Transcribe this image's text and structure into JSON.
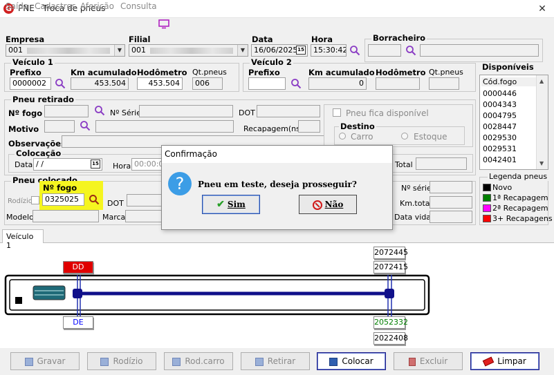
{
  "window": {
    "title": "PNE - Troca de pneus",
    "app_icon_letter": "G",
    "close": "✕"
  },
  "menu": [
    "Saída",
    "Cadastros",
    "Aferição",
    "Consulta"
  ],
  "header": {
    "empresa_label": "Empresa",
    "empresa_value": "001",
    "filial_label": "Filial",
    "filial_value": "001",
    "data_label": "Data",
    "data_value": "16/06/2025",
    "hora_label": "Hora",
    "hora_value": "15:30:42",
    "borracheiro_label": "Borracheiro",
    "cal_icon": "15"
  },
  "veiculo1": {
    "title": "Veículo 1",
    "prefixo_label": "Prefixo",
    "prefixo_value": "0000002",
    "km_label": "Km acumulado",
    "km_value": "453.504",
    "hodometro_label": "Hodômetro",
    "hodometro_value": "453.504",
    "qtpneus_label": "Qt.pneus",
    "qtpneus_value": "006"
  },
  "veiculo2": {
    "title": "Veículo 2",
    "prefixo_label": "Prefixo",
    "km_label": "Km acumulado",
    "km_value": "0",
    "hodometro_label": "Hodômetro",
    "qtpneus_label": "Qt.pneus"
  },
  "disponiveis": {
    "title": "Disponíveis",
    "header": "Cód.fogo",
    "items": [
      "0000446",
      "0004343",
      "0004795",
      "0028447",
      "0029530",
      "0029531",
      "0042401"
    ]
  },
  "pneu_retirado": {
    "title": "Pneu retirado",
    "nfogo_label": "Nº fogo",
    "nserie_label": "Nº Série",
    "dot_label": "DOT",
    "motivo_label": "Motivo",
    "recapagem_label": "Recapagem(ns)",
    "observacoes_label": "Observações",
    "fica_disponivel_label": "Pneu fica disponível",
    "destino_title": "Destino",
    "carro_label": "Carro",
    "estoque_label": "Estoque",
    "colocacao_title": "Colocação",
    "data_label": "Data",
    "data_value": " /  /",
    "hora_label": "Hora",
    "hora_value": "00:00:00",
    "total_label": "Total"
  },
  "pneu_colocado": {
    "title": "Pneu colocado",
    "rodizio_label": "Rodízio",
    "nfogo_label": "Nº fogo",
    "nfogo_value": "0325025",
    "dot_label": "DOT",
    "modelo_label": "Modelo",
    "marca_label": "Marca",
    "nserie_label": "Nº série",
    "kmtotal_label": "Km.total",
    "datavida_label": "Data vida"
  },
  "legenda": {
    "title": "Legenda pneus",
    "items": [
      {
        "label": "Novo",
        "color": "#000000"
      },
      {
        "label": "1ª Recapagem",
        "color": "#008000"
      },
      {
        "label": "2ª Recapagem",
        "color": "#ff00ff"
      },
      {
        "label": "3+ Recapagens",
        "color": "#ff0000"
      }
    ]
  },
  "tab": {
    "label": "Veículo 1"
  },
  "diagram": {
    "dd_label": "DD",
    "de_label": "DE",
    "rear_top_outer": "2072445",
    "rear_top_inner": "2072415",
    "rear_bottom_inner": "2052332",
    "rear_bottom_outer": "2022408",
    "dd_color": "#e00000",
    "de_color": "#0000ff",
    "recap1_color": "#008000"
  },
  "buttons": {
    "gravar": "Gravar",
    "rodizio": "Rodízio",
    "rodcarro": "Rod.carro",
    "retirar": "Retirar",
    "colocar": "Colocar",
    "excluir": "Excluir",
    "limpar": "Limpar"
  },
  "dialog": {
    "title": "Confirmação",
    "message": "Pneu em teste, deseja prosseguir?",
    "yes": "Sim",
    "no": "Não",
    "icon": "?"
  }
}
